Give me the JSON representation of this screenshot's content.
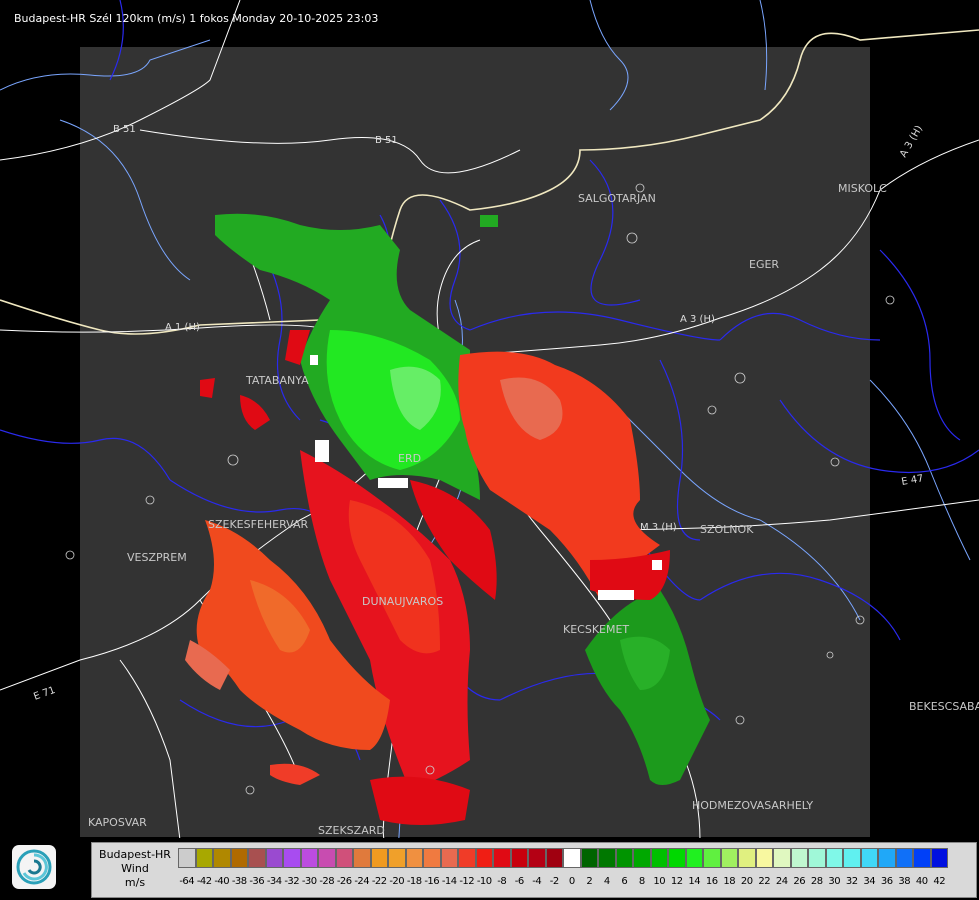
{
  "title": "Budapest-HR Szél 120km (m/s) 1 fokos Monday 20-10-2025 23:03",
  "map": {
    "cities": [
      "SALGOTARJAN",
      "MISKOLC",
      "EGER",
      "TATABANYA",
      "ERD",
      "SZEKESFEHERVAR",
      "VESZPREM",
      "DUNAUJVAROS",
      "KECSKEMET",
      "SZOLNOK",
      "KAPOSVAR",
      "SZEKSZARD",
      "HODMEZOVASARHELY",
      "BEKESCSABA"
    ],
    "road_labels": [
      "B 51",
      "B 51",
      "A 3 (H)",
      "A 3 (H)",
      "A 1 (H)",
      "E 71",
      "E 47",
      "M 3 (H)"
    ],
    "colors": {
      "background": "#000000",
      "radar_area": "#333333",
      "borders": "#3a3aff",
      "roads": "#ffffff",
      "rivers": "#7aa6ff"
    }
  },
  "legend": {
    "line1": "Budapest-HR",
    "line2": "Wind",
    "line3": "m/s",
    "values": [
      "-64",
      "-42",
      "-40",
      "-38",
      "-36",
      "-34",
      "-32",
      "-30",
      "-28",
      "-26",
      "-24",
      "-22",
      "-20",
      "-18",
      "-16",
      "-14",
      "-12",
      "-10",
      "-8",
      "-6",
      "-4",
      "-2",
      "0",
      "2",
      "4",
      "6",
      "8",
      "10",
      "12",
      "14",
      "16",
      "18",
      "20",
      "22",
      "24",
      "26",
      "28",
      "30",
      "32",
      "34",
      "36",
      "38",
      "40",
      "42"
    ],
    "colors": [
      "#cccccc",
      "#a8a800",
      "#b08800",
      "#b06a00",
      "#a85050",
      "#9a4ad0",
      "#a84cf0",
      "#bc4ce0",
      "#c84cb0",
      "#d0507a",
      "#e07a3c",
      "#f09a20",
      "#f0a02a",
      "#f09040",
      "#f07a40",
      "#e86a50",
      "#f03c28",
      "#f01e14",
      "#e00a14",
      "#c8000c",
      "#b40014",
      "#a00010",
      "#ffffff",
      "#006400",
      "#007800",
      "#009400",
      "#00a800",
      "#00c000",
      "#00d800",
      "#20f020",
      "#60f040",
      "#a0f060",
      "#e0f080",
      "#f8f8a0",
      "#e0f8c0",
      "#c0f8d0",
      "#a0f8d8",
      "#80f8e8",
      "#60f0f0",
      "#40d8f8",
      "#20a8f8",
      "#1070f8",
      "#0040f8",
      "#0010e0"
    ]
  }
}
